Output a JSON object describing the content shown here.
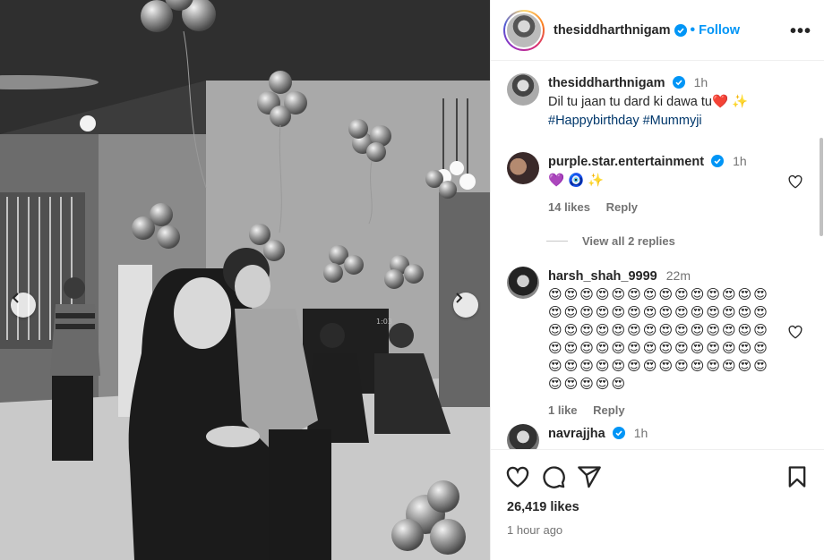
{
  "post": {
    "username": "thesiddharthnigam",
    "follow_label": "Follow",
    "separator": "•",
    "more_label": "•••",
    "caption": {
      "username": "thesiddharthnigam",
      "time": "1h",
      "text": "Dil tu jaan tu dard ki dawa tu❤️ ✨",
      "hashtags": "#Happybirthday #Mummyji"
    },
    "likes": "26,419 likes",
    "time_ago": "1 hour ago"
  },
  "comments": [
    {
      "username": "purple.star.entertainment",
      "verified": true,
      "time": "1h",
      "text": "💜 🧿 ✨",
      "likes": "14 likes",
      "reply": "Reply",
      "view_replies": "View all 2 replies"
    },
    {
      "username": "harsh_shah_9999",
      "verified": false,
      "time": "22m",
      "text": "😍😍😍😍😍😍😍😍😍😍😍😍😍😍😍😍😍😍😍😍😍😍😍😍😍😍😍😍😍😍😍😍😍😍😍😍😍😍😍😍😍😍😍😍😍😍😍😍😍😍😍😍😍😍😍😍😍😍😍😍😍😍😍😍😍😍😍😍😍😍😍😍😍😍😍",
      "likes": "1 like",
      "reply": "Reply"
    },
    {
      "username": "navrajjha",
      "verified": true,
      "time": "1h",
      "text": "",
      "likes": "",
      "reply": ""
    }
  ],
  "photo": {
    "tv_clock": "1:03"
  },
  "colors": {
    "accent": "#0095f6",
    "verified": "#0095f6",
    "hashtag": "#00376b",
    "muted": "#737373"
  },
  "icons": [
    "heart-icon",
    "comment-icon",
    "share-icon",
    "bookmark-icon",
    "chevron-left-icon",
    "chevron-right-icon",
    "verified-icon",
    "more-icon"
  ]
}
